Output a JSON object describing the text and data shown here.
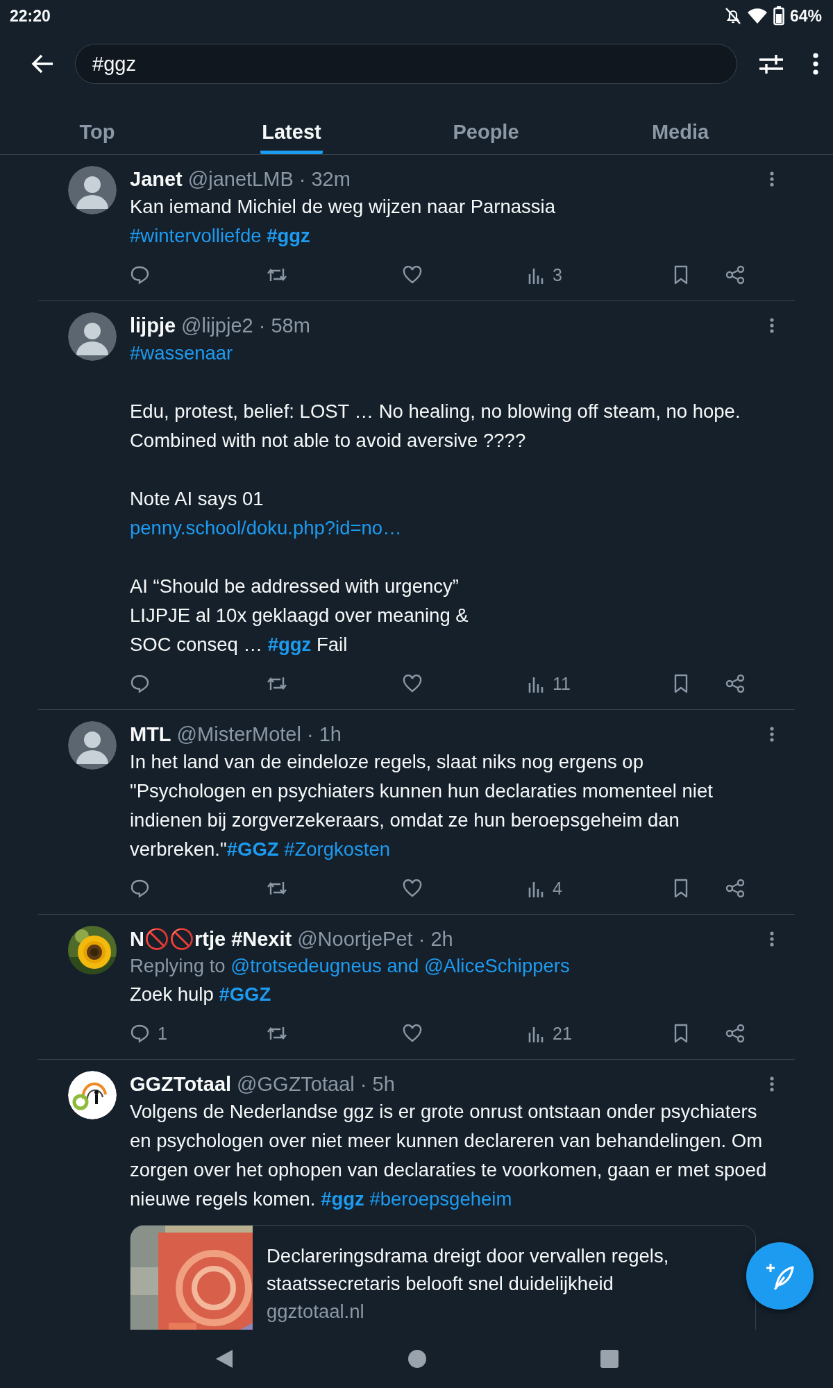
{
  "status_bar": {
    "time": "22:20",
    "battery": "64%"
  },
  "search": {
    "value": "#ggz"
  },
  "tabs": [
    {
      "label": "Top",
      "selected": false
    },
    {
      "label": "Latest",
      "selected": true
    },
    {
      "label": "People",
      "selected": false
    },
    {
      "label": "Media",
      "selected": false
    }
  ],
  "tweets": [
    {
      "name": "Janet",
      "meta": "@janetLMB · 32m",
      "avatar": {
        "kind": "person"
      },
      "body": [
        {
          "kind": "text",
          "text": "Kan iemand Michiel de weg wijzen naar Parnassia\n"
        },
        {
          "kind": "tag",
          "text": "#wintervolliefde ",
          "bold": false
        },
        {
          "kind": "tag",
          "text": "#ggz",
          "bold": true
        }
      ],
      "stats": {
        "views": "3"
      }
    },
    {
      "name": "lijpje",
      "meta": "@lijpje2 · 58m",
      "avatar": {
        "kind": "person"
      },
      "body": [
        {
          "kind": "tag",
          "text": "#wassenaar",
          "bold": false
        },
        {
          "kind": "text",
          "text": "\n\nEdu, protest, belief: LOST … No healing, no blowing off steam, no hope. Combined with not able to avoid aversive ????\n\nNote AI says 01\n"
        },
        {
          "kind": "link",
          "text": "penny.school/doku.php?id=no…"
        },
        {
          "kind": "text",
          "text": "\n\nAI “Should be addressed with urgency”\nLIJPJE al 10x geklaagd over meaning &\nSOC conseq … "
        },
        {
          "kind": "tag",
          "text": "#ggz",
          "bold": true
        },
        {
          "kind": "text",
          "text": " Fail"
        }
      ],
      "stats": {
        "views": "11"
      }
    },
    {
      "name": "MTL",
      "meta": "@MisterMotel · 1h",
      "avatar": {
        "kind": "person"
      },
      "body": [
        {
          "kind": "text",
          "text": "In het land van de eindeloze regels, slaat niks nog ergens op\n\"Psychologen en psychiaters kunnen hun declaraties momenteel niet indienen bij zorgverzekeraars, omdat ze hun beroepsgeheim dan verbreken.\""
        },
        {
          "kind": "tag",
          "text": "#GGZ ",
          "bold": true
        },
        {
          "kind": "tag",
          "text": "#Zorgkosten",
          "bold": false
        }
      ],
      "stats": {
        "views": "4"
      }
    },
    {
      "name": "N🚫🚫rtje #Nexit",
      "meta": "@NoortjePet · 2h",
      "avatar": {
        "kind": "picture"
      },
      "reply_to": [
        {
          "kind": "text",
          "text": "Replying to "
        },
        {
          "kind": "mention",
          "text": "@trotsedeugneus and @AliceSchippers"
        }
      ],
      "body": [
        {
          "kind": "text",
          "text": "Zoek hulp "
        },
        {
          "kind": "tag",
          "text": "#GGZ",
          "bold": true
        }
      ],
      "stats": {
        "replies": "1",
        "views": "21"
      }
    },
    {
      "name": "GGZTotaal",
      "meta": "@GGZTotaal · 5h",
      "avatar": {
        "kind": "logo"
      },
      "body": [
        {
          "kind": "text",
          "text": "Volgens de Nederlandse ggz is er grote onrust ontstaan onder psychiaters en psychologen over niet meer kunnen declareren van behandelingen. Om zorgen over het ophopen van declaraties te voorkomen, gaan er met spoed nieuwe regels komen. "
        },
        {
          "kind": "tag",
          "text": "#ggz ",
          "bold": true
        },
        {
          "kind": "tag",
          "text": "#beroepsgeheim",
          "bold": false
        }
      ],
      "card": {
        "image": {
          "kind": "picture"
        },
        "title": "Declareringsdrama dreigt door vervallen regels, staatssecretaris belooft snel duidelijkheid",
        "domain": "ggztotaal.nl"
      }
    }
  ]
}
